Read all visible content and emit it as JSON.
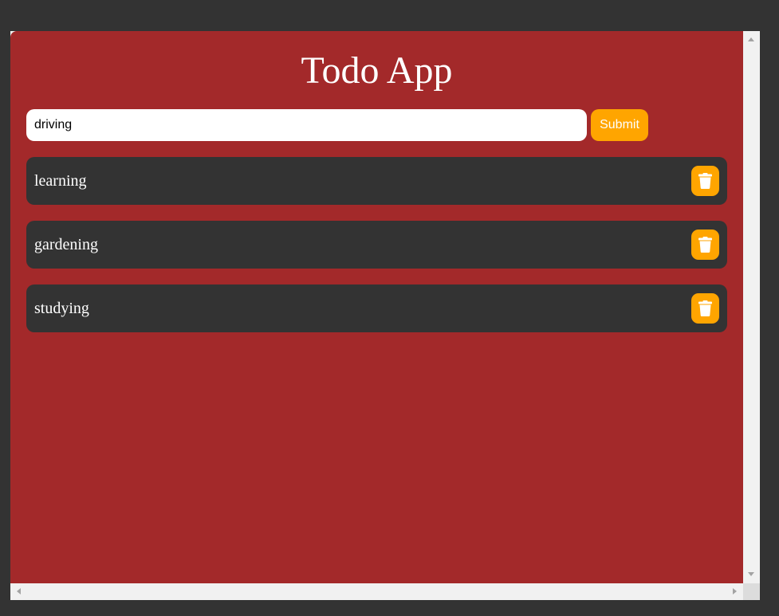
{
  "app": {
    "title": "Todo App"
  },
  "form": {
    "input_value": "driving",
    "submit_label": "Submit"
  },
  "todos": [
    {
      "text": "learning",
      "delete_icon": "trash-icon"
    },
    {
      "text": "gardening",
      "delete_icon": "trash-icon"
    },
    {
      "text": "studying",
      "delete_icon": "trash-icon"
    }
  ],
  "colors": {
    "page_background": "#333333",
    "app_background": "#a3292a",
    "item_background": "#333333",
    "accent": "#ffa500",
    "text": "#ffffff"
  }
}
